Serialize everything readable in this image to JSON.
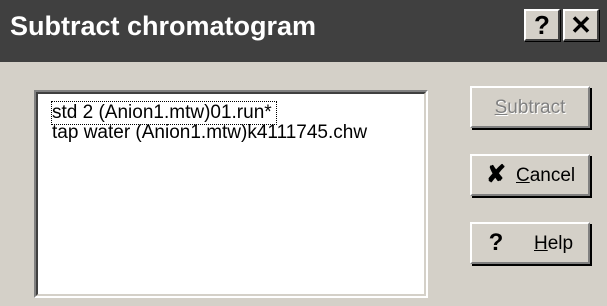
{
  "window": {
    "title": "Subtract chromatogram",
    "help_glyph": "?",
    "close_glyph": "✕"
  },
  "list": {
    "items": [
      "std 2 (Anion1.mtw)01.run*",
      "tap water (Anion1.mtw)k4111745.chw"
    ]
  },
  "buttons": {
    "subtract": {
      "mnemonic": "S",
      "rest": "ubtract",
      "enabled": false
    },
    "cancel": {
      "mnemonic": "C",
      "rest": "ancel",
      "icon": "cancel-x-icon",
      "glyph": "✘"
    },
    "help": {
      "mnemonic": "H",
      "rest": "elp",
      "icon": "question-mark-icon",
      "glyph": "?"
    }
  },
  "colors": {
    "title_bar": "#404040",
    "face": "#d4d0c8",
    "disabled_text": "#808080"
  }
}
